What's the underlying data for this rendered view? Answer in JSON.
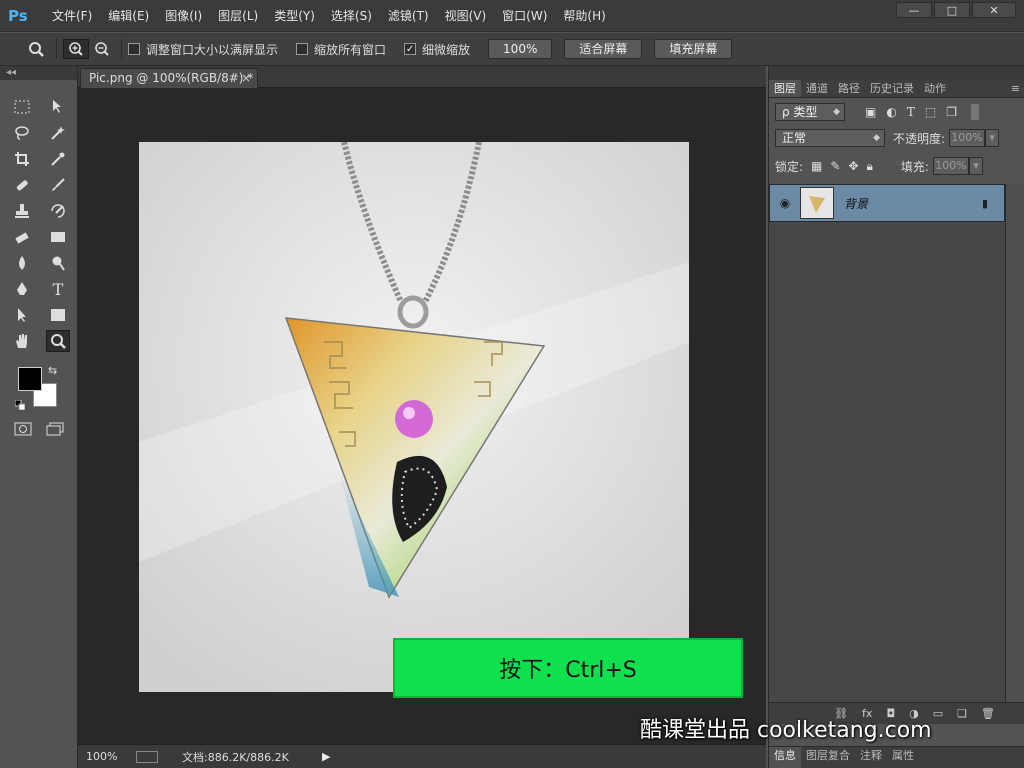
{
  "app": {
    "logo": "Ps",
    "accent": "#4fb3ff"
  },
  "menu": [
    "文件(F)",
    "编辑(E)",
    "图像(I)",
    "图层(L)",
    "类型(Y)",
    "选择(S)",
    "滤镜(T)",
    "视图(V)",
    "窗口(W)",
    "帮助(H)"
  ],
  "window_controls": {
    "minimize": "—",
    "maximize": "□",
    "close": "✕"
  },
  "options": {
    "zoom_tool_icon": "magnifier-icon",
    "check_resize_label": "调整窗口大小以满屏显示",
    "check_zoom_all_label": "缩放所有窗口",
    "check_scrubby_label": "细微缩放",
    "scrubby_checked": "✓",
    "btn_100": "100%",
    "btn_fit": "适合屏幕",
    "btn_fill": "填充屏幕"
  },
  "document": {
    "tab_title": "Pic.png @ 100%(RGB/8#) *",
    "tab_close": "×"
  },
  "status": {
    "zoom": "100%",
    "doc_info": "文档:886.2K/886.2K",
    "arrow": "▶"
  },
  "overlay": {
    "text": "按下：Ctrl+S"
  },
  "watermark": {
    "text": "酷课堂出品 coolketang.com"
  },
  "layers_panel": {
    "tabs": [
      "图层",
      "通道",
      "路径",
      "历史记录",
      "动作"
    ],
    "kind_label": "ρ 类型",
    "blend_mode": "正常",
    "opacity_label": "不透明度:",
    "opacity_value": "100%",
    "lock_label": "锁定:",
    "fill_label": "填充:",
    "fill_value": "100%",
    "layer_name": "背景"
  },
  "bottom_tabs": [
    "信息",
    "图层复合",
    "注释",
    "属性"
  ]
}
